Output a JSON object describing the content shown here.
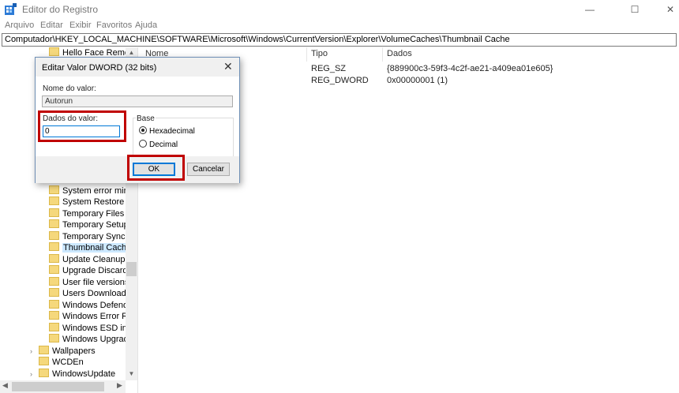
{
  "window": {
    "title": "Editor do Registro",
    "minimize": "—",
    "maximize": "☐",
    "close": "✕"
  },
  "menu": [
    {
      "label": "Arquivo"
    },
    {
      "label": "Editar"
    },
    {
      "label": "Exibir"
    },
    {
      "label": "Favoritos"
    },
    {
      "label": "Ajuda"
    }
  ],
  "address": "Computador\\HKEY_LOCAL_MACHINE\\SOFTWARE\\Microsoft\\Windows\\CurrentVersion\\Explorer\\VolumeCaches\\Thumbnail Cache",
  "tree": {
    "items": [
      {
        "label": "Hello Face Remove"
      },
      {
        "label": "System error minid"
      },
      {
        "label": "System Restore Poi"
      },
      {
        "label": "Temporary Files"
      },
      {
        "label": "Temporary Setup F"
      },
      {
        "label": "Temporary Sync Fil"
      },
      {
        "label": "Thumbnail Cache"
      },
      {
        "label": "Update Cleanup"
      },
      {
        "label": "Upgrade Discarded"
      },
      {
        "label": "User file versions"
      },
      {
        "label": "Users Download Fo"
      },
      {
        "label": "Windows Defender"
      },
      {
        "label": "Windows Error Rep"
      },
      {
        "label": "Windows ESD insta"
      },
      {
        "label": "Windows Upgrade"
      },
      {
        "label": "Wallpapers"
      },
      {
        "label": "WCDEn"
      },
      {
        "label": "WindowsUpdate"
      }
    ],
    "expander_glyph": "›",
    "scroll_up": "▲",
    "scroll_down": "▼",
    "scroll_left": "◀",
    "scroll_right": "▶"
  },
  "list": {
    "columns": [
      "Nome",
      "Tipo",
      "Dados"
    ],
    "rows": [
      {
        "tipo": "REG_SZ",
        "dados": "{889900c3-59f3-4c2f-ae21-a409ea01e605}"
      },
      {
        "tipo": "REG_DWORD",
        "dados": "0x00000001 (1)"
      }
    ]
  },
  "dialog": {
    "title": "Editar Valor DWORD (32 bits)",
    "close": "✕",
    "name_label": "Nome do valor:",
    "name_value": "Autorun",
    "data_label": "Dados do valor:",
    "data_value": "0",
    "base_label": "Base",
    "radio_hex": "Hexadecimal",
    "radio_dec": "Decimal",
    "ok": "OK",
    "cancel": "Cancelar"
  },
  "colors": {
    "highlight_box": "#c00000",
    "selection": "#cce8ff",
    "focus": "#0078d7"
  }
}
